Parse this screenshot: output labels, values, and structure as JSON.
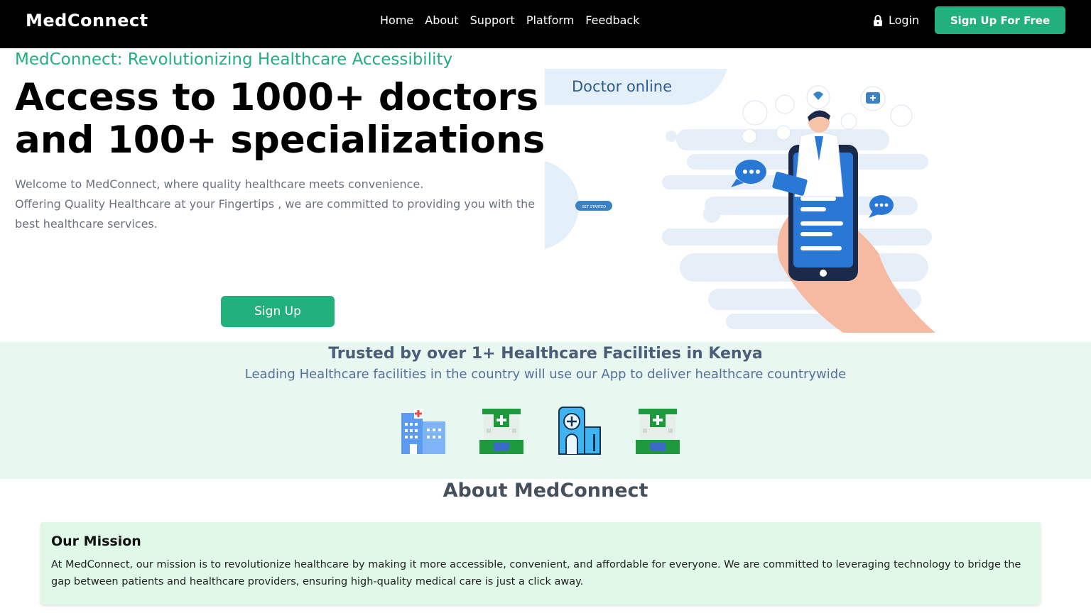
{
  "nav": {
    "brand": "MedConnect",
    "links": [
      "Home",
      "About",
      "Support",
      "Platform",
      "Feedback"
    ],
    "login": "Login",
    "cta": "Sign Up For Free"
  },
  "hero": {
    "kicker": "MedConnect: Revolutionizing Healthcare Accessibility",
    "headline_line1": "Access to 1000+ doctors",
    "headline_line2": "and 100+ specializations",
    "intro_line1": "Welcome to MedConnect, where quality healthcare meets convenience.",
    "intro_line2": "Offering Quality Healthcare at your Fingertips , we are committed to providing you with the best healthcare services.",
    "button": "Sign Up",
    "art_badge": "Doctor online",
    "art_pill": "GET STARTED"
  },
  "trust": {
    "title": "Trusted by over 1+ Healthcare Facilities in Kenya",
    "subtitle": "Leading Healthcare facilities in the country will use our App to deliver healthcare countrywide",
    "facility_icons": [
      "hospital-building-icon",
      "green-clinic-icon",
      "medical-building-icon",
      "green-clinic-icon"
    ]
  },
  "about": {
    "title": "About MedConnect",
    "mission_title": "Our Mission",
    "mission_text": "At MedConnect, our mission is to revolutionize healthcare by making it more accessible, convenient, and affordable for everyone. We are committed to leveraging technology to bridge the gap between patients and healthcare providers, ensuring high-quality medical care is just a click away."
  },
  "colors": {
    "accent": "#22b07d",
    "nav_bg": "#000000",
    "trust_bg": "#e8f7ef",
    "mission_bg": "#dff8e8"
  }
}
